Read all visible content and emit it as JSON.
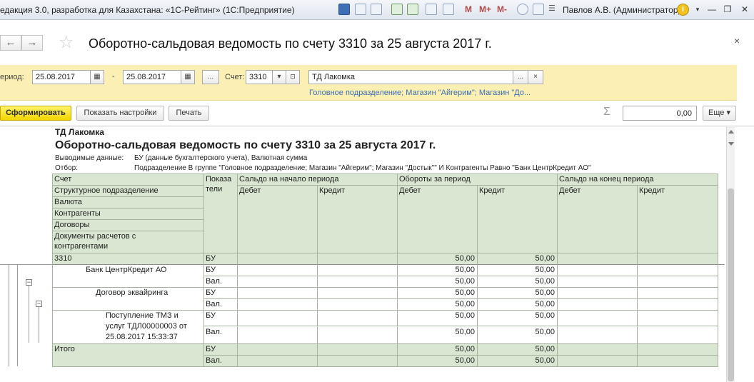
{
  "window": {
    "title": "едакция 3.0, разработка для Казахстана: «1С-Рейтинг» (1С:Предприятие)",
    "toolbar_icons": [
      "save-icon",
      "print-icon",
      "preview-icon",
      "attach-icon",
      "upload-icon",
      "calculator-icon",
      "calendar-icon"
    ],
    "memory_buttons": [
      "M",
      "M+",
      "M-"
    ],
    "user": "Павлов А.В. (Администратор)",
    "info_glyph": "i"
  },
  "header": {
    "back": "←",
    "forward": "→",
    "title": "Оборотно-сальдовая ведомость по счету 3310  за 25 августа 2017 г.",
    "close": "×"
  },
  "filters": {
    "period_label": "ериод:",
    "date_from": "25.08.2017",
    "dash": "-",
    "date_to": "25.08.2017",
    "ellipsis": "...",
    "account_label": "Счет:",
    "account": "3310",
    "org": "ТД Лакомка",
    "clear": "×",
    "link": "Головное подразделение; Магазин \"Айгерим\"; Магазин \"До..."
  },
  "commands": {
    "generate": "Сформировать",
    "settings": "Показать настройки",
    "print": "Печать",
    "sum_value": "0,00",
    "more": "Еще ▾"
  },
  "report": {
    "company": "ТД Лакомка",
    "title": "Оборотно-сальдовая ведомость по счету 3310  за 25 августа 2017 г.",
    "output_label": "Выводимые данные:",
    "output_value": "БУ (данные бухгалтерского учета), Валютная сумма",
    "filter_label": "Отбор:",
    "filter_value": "Подразделение В группе \"Головное подразделение; Магазин \"Айгерим\"; Магазин \"Достык\"\" И Контрагенты Равно \"Банк ЦентрКредит АО\"",
    "columns": {
      "account": "Счет",
      "dept": "Структурное подразделение",
      "currency": "Валюта",
      "counterparty": "Контрагенты",
      "contracts": "Договоры",
      "docs1": "Документы расчетов с",
      "docs2": "контрагентами",
      "indicators1": "Показа",
      "indicators2": "тели",
      "opening": "Сальдо на начало периода",
      "turnover": "Обороты за период",
      "closing": "Сальдо на конец периода",
      "debit": "Дебет",
      "credit": "Кредит"
    },
    "rows": {
      "acc_name": "3310",
      "acc_ind": "БУ",
      "acc_dt": "50,00",
      "acc_kt": "50,00",
      "bank_name": "Банк ЦентрКредит АО",
      "bank_ind1": "БУ",
      "bank_ind2": "Вал.",
      "bank_dt1": "50,00",
      "bank_kt1": "50,00",
      "bank_dt2": "50,00",
      "bank_kt2": "50,00",
      "contract_name": "Договор эквайринга",
      "contract_ind1": "БУ",
      "contract_ind2": "Вал.",
      "contract_dt1": "50,00",
      "contract_kt1": "50,00",
      "contract_dt2": "50,00",
      "contract_kt2": "50,00",
      "doc_line1": "Поступление ТМЗ и",
      "doc_line2": "услуг ТДЛ00000003 от",
      "doc_line3": "25.08.2017 15:33:37",
      "doc_ind1": "БУ",
      "doc_ind2": "Вал.",
      "doc_dt1": "50,00",
      "doc_kt1": "50,00",
      "doc_dt2": "50,00",
      "doc_kt2": "50,00",
      "total_name": "Итого",
      "total_ind1": "БУ",
      "total_ind2": "Вал.",
      "total_dt1": "50,00",
      "total_kt1": "50,00",
      "total_dt2": "50,00",
      "total_kt2": "50,00"
    }
  },
  "colors": {
    "accent_yellow": "#fbefb3",
    "header_green": "#d9e7d2",
    "link_blue": "#3a6fb5"
  }
}
